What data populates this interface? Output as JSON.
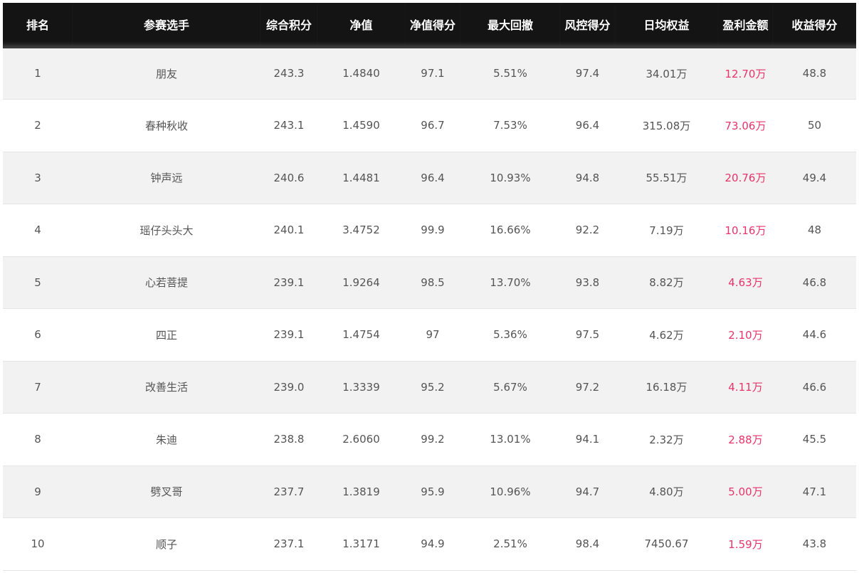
{
  "colors": {
    "header_bg": "#141414",
    "header_text": "#ffffff",
    "row_alt": "#f2f2f2",
    "row_base": "#ffffff",
    "body_text": "#555555",
    "profit_text": "#e8336c"
  },
  "table": {
    "headers": [
      "排名",
      "参赛选手",
      "综合积分",
      "净值",
      "净值得分",
      "最大回撤",
      "风控得分",
      "日均权益",
      "盈利金额",
      "收益得分"
    ],
    "rows": [
      [
        "1",
        "朋友",
        "243.3",
        "1.4840",
        "97.1",
        "5.51%",
        "97.4",
        "34.01万",
        "12.70万",
        "48.8"
      ],
      [
        "2",
        "春种秋收",
        "243.1",
        "1.4590",
        "96.7",
        "7.53%",
        "96.4",
        "315.08万",
        "73.06万",
        "50"
      ],
      [
        "3",
        "钟声远",
        "240.6",
        "1.4481",
        "96.4",
        "10.93%",
        "94.8",
        "55.51万",
        "20.76万",
        "49.4"
      ],
      [
        "4",
        "瑶仔头头大",
        "240.1",
        "3.4752",
        "99.9",
        "16.66%",
        "92.2",
        "7.19万",
        "10.16万",
        "48"
      ],
      [
        "5",
        "心若菩提",
        "239.1",
        "1.9264",
        "98.5",
        "13.70%",
        "93.8",
        "8.82万",
        "4.63万",
        "46.8"
      ],
      [
        "6",
        "四正",
        "239.1",
        "1.4754",
        "97",
        "5.36%",
        "97.5",
        "4.62万",
        "2.10万",
        "44.6"
      ],
      [
        "7",
        "改善生活",
        "239.0",
        "1.3339",
        "95.2",
        "5.67%",
        "97.2",
        "16.18万",
        "4.11万",
        "46.6"
      ],
      [
        "8",
        "朱迪",
        "238.8",
        "2.6060",
        "99.2",
        "13.01%",
        "94.1",
        "2.32万",
        "2.88万",
        "45.5"
      ],
      [
        "9",
        "劈叉哥",
        "237.7",
        "1.3819",
        "95.9",
        "10.96%",
        "94.7",
        "4.80万",
        "5.00万",
        "47.1"
      ],
      [
        "10",
        "顺子",
        "237.1",
        "1.3171",
        "94.9",
        "2.51%",
        "98.4",
        "7450.67",
        "1.59万",
        "43.8"
      ]
    ]
  }
}
